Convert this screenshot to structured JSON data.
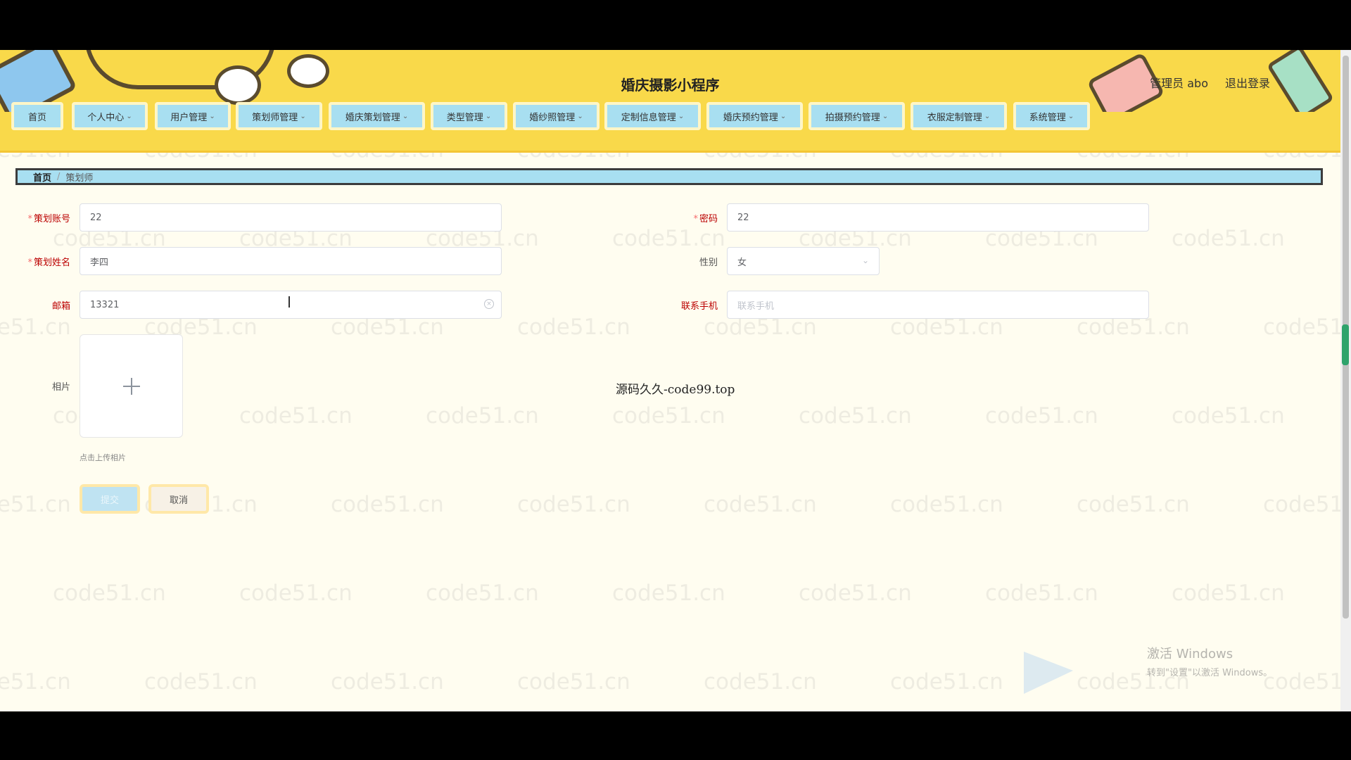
{
  "header": {
    "title": "婚庆摄影小程序",
    "user_label": "管理员 abo",
    "logout_label": "退出登录"
  },
  "nav": {
    "items": [
      {
        "label": "首页",
        "has_dropdown": false
      },
      {
        "label": "个人中心",
        "has_dropdown": true
      },
      {
        "label": "用户管理",
        "has_dropdown": true
      },
      {
        "label": "策划师管理",
        "has_dropdown": true
      },
      {
        "label": "婚庆策划管理",
        "has_dropdown": true
      },
      {
        "label": "类型管理",
        "has_dropdown": true
      },
      {
        "label": "婚纱照管理",
        "has_dropdown": true
      },
      {
        "label": "定制信息管理",
        "has_dropdown": true
      },
      {
        "label": "婚庆预约管理",
        "has_dropdown": true
      },
      {
        "label": "拍摄预约管理",
        "has_dropdown": true
      },
      {
        "label": "衣服定制管理",
        "has_dropdown": true
      },
      {
        "label": "系统管理",
        "has_dropdown": true
      }
    ]
  },
  "breadcrumb": {
    "home": "首页",
    "separator": "/",
    "current": "策划师"
  },
  "form": {
    "account": {
      "label": "策划账号",
      "value": "22",
      "required": true
    },
    "password": {
      "label": "密码",
      "value": "22",
      "required": true
    },
    "name": {
      "label": "策划姓名",
      "value": "李四",
      "required": true
    },
    "gender": {
      "label": "性别",
      "value": "女"
    },
    "email": {
      "label": "邮箱",
      "value": "13321"
    },
    "phone": {
      "label": "联系手机",
      "value": "",
      "placeholder": "联系手机"
    },
    "photo": {
      "label": "相片",
      "tip": "点击上传相片"
    },
    "submit_label": "提交",
    "cancel_label": "取消"
  },
  "overlay_text": "源码久久-code99.top",
  "watermark": "code51.cn",
  "windows": {
    "activate_title": "激活 Windows",
    "activate_sub": "转到\"设置\"以激活 Windows。"
  },
  "colors": {
    "header_bg": "#f9d94a",
    "nav_item_bg": "#a8dff1",
    "page_bg": "#fffdf0",
    "required_label": "#b00000"
  }
}
